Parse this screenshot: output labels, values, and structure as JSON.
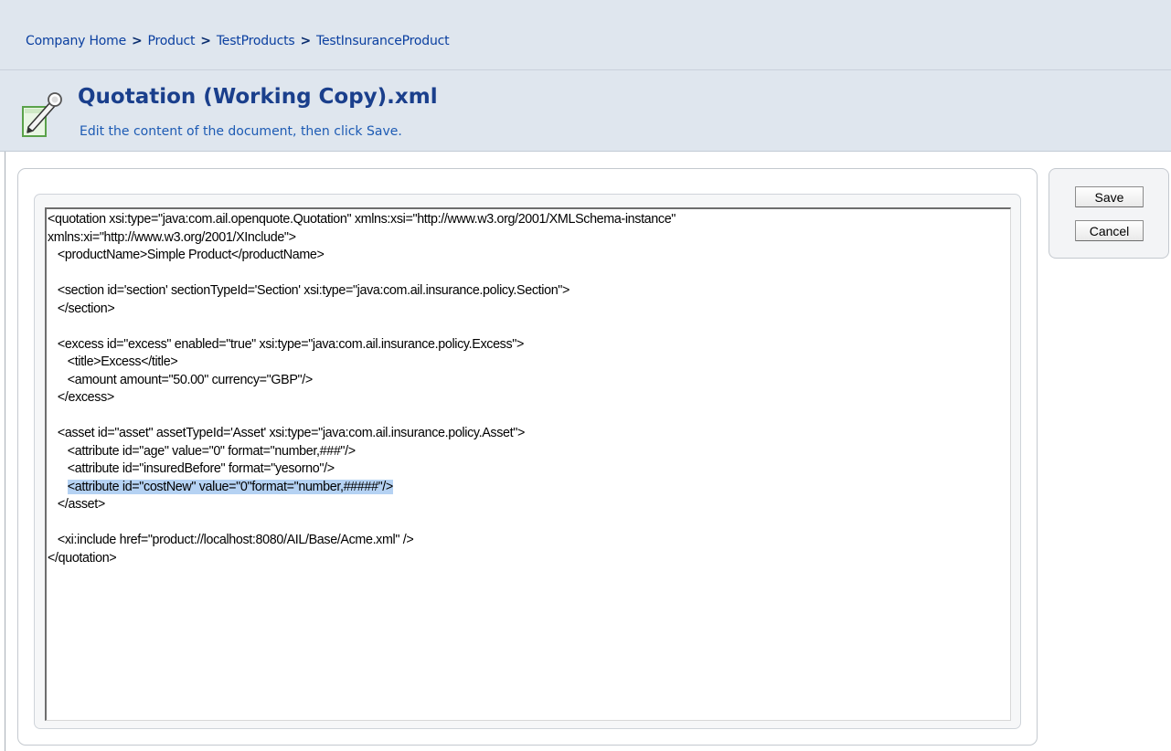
{
  "breadcrumb": {
    "items": [
      "Company Home",
      "Product",
      "TestProducts",
      "TestInsuranceProduct"
    ],
    "separator": ">"
  },
  "header": {
    "title": "Quotation (Working Copy).xml",
    "subtitle": "Edit the content of the document, then click Save.",
    "icon": "edit-document-icon"
  },
  "editor": {
    "lines": [
      "<quotation xsi:type=\"java:com.ail.openquote.Quotation\" xmlns:xsi=\"http://www.w3.org/2001/XMLSchema-instance\"",
      "xmlns:xi=\"http://www.w3.org/2001/XInclude\">",
      "   <productName>Simple Product</productName>",
      "",
      "   <section id='section' sectionTypeId='Section' xsi:type=\"java:com.ail.insurance.policy.Section\">",
      "   </section>",
      "",
      "   <excess id=\"excess\" enabled=\"true\" xsi:type=\"java:com.ail.insurance.policy.Excess\">",
      "      <title>Excess</title>",
      "      <amount amount=\"50.00\" currency=\"GBP\"/>",
      "   </excess>",
      "",
      "   <asset id=\"asset\" assetTypeId='Asset' xsi:type=\"java:com.ail.insurance.policy.Asset\">",
      "      <attribute id=\"age\" value=\"0\" format=\"number,###\"/>",
      "      <attribute id=\"insuredBefore\" format=\"yesorno\"/>",
      "      <attribute id=\"costNew\" value=\"0\"format=\"number,#####\"/>",
      "   </asset>",
      "",
      "   <xi:include href=\"product://localhost:8080/AIL/Base/Acme.xml\" />",
      "</quotation>"
    ],
    "highlighted_line": 15,
    "highlight_color": "#b5d2f3"
  },
  "actions": {
    "save_label": "Save",
    "cancel_label": "Cancel"
  }
}
